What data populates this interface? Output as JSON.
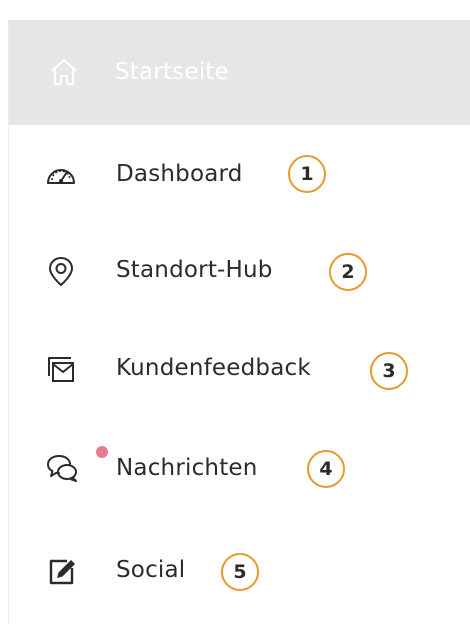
{
  "nav": {
    "home": {
      "label": "Startseite",
      "icon": "home-icon"
    },
    "items": [
      {
        "label": "Dashboard",
        "icon": "speedometer-icon",
        "badge": "1"
      },
      {
        "label": "Standort-Hub",
        "icon": "location-pin-icon",
        "badge": "2"
      },
      {
        "label": "Kundenfeedback",
        "icon": "feedback-inbox-icon",
        "badge": "3"
      },
      {
        "label": "Nachrichten",
        "icon": "chat-bubbles-icon",
        "badge": "4",
        "unread_indicator": true
      },
      {
        "label": "Social",
        "icon": "edit-square-icon",
        "badge": "5"
      }
    ]
  },
  "colors": {
    "home_bg": "#e6e6e6",
    "badge_border": "#e69a2e",
    "unread_dot": "#e57b8c",
    "text": "#2b2b2b"
  }
}
